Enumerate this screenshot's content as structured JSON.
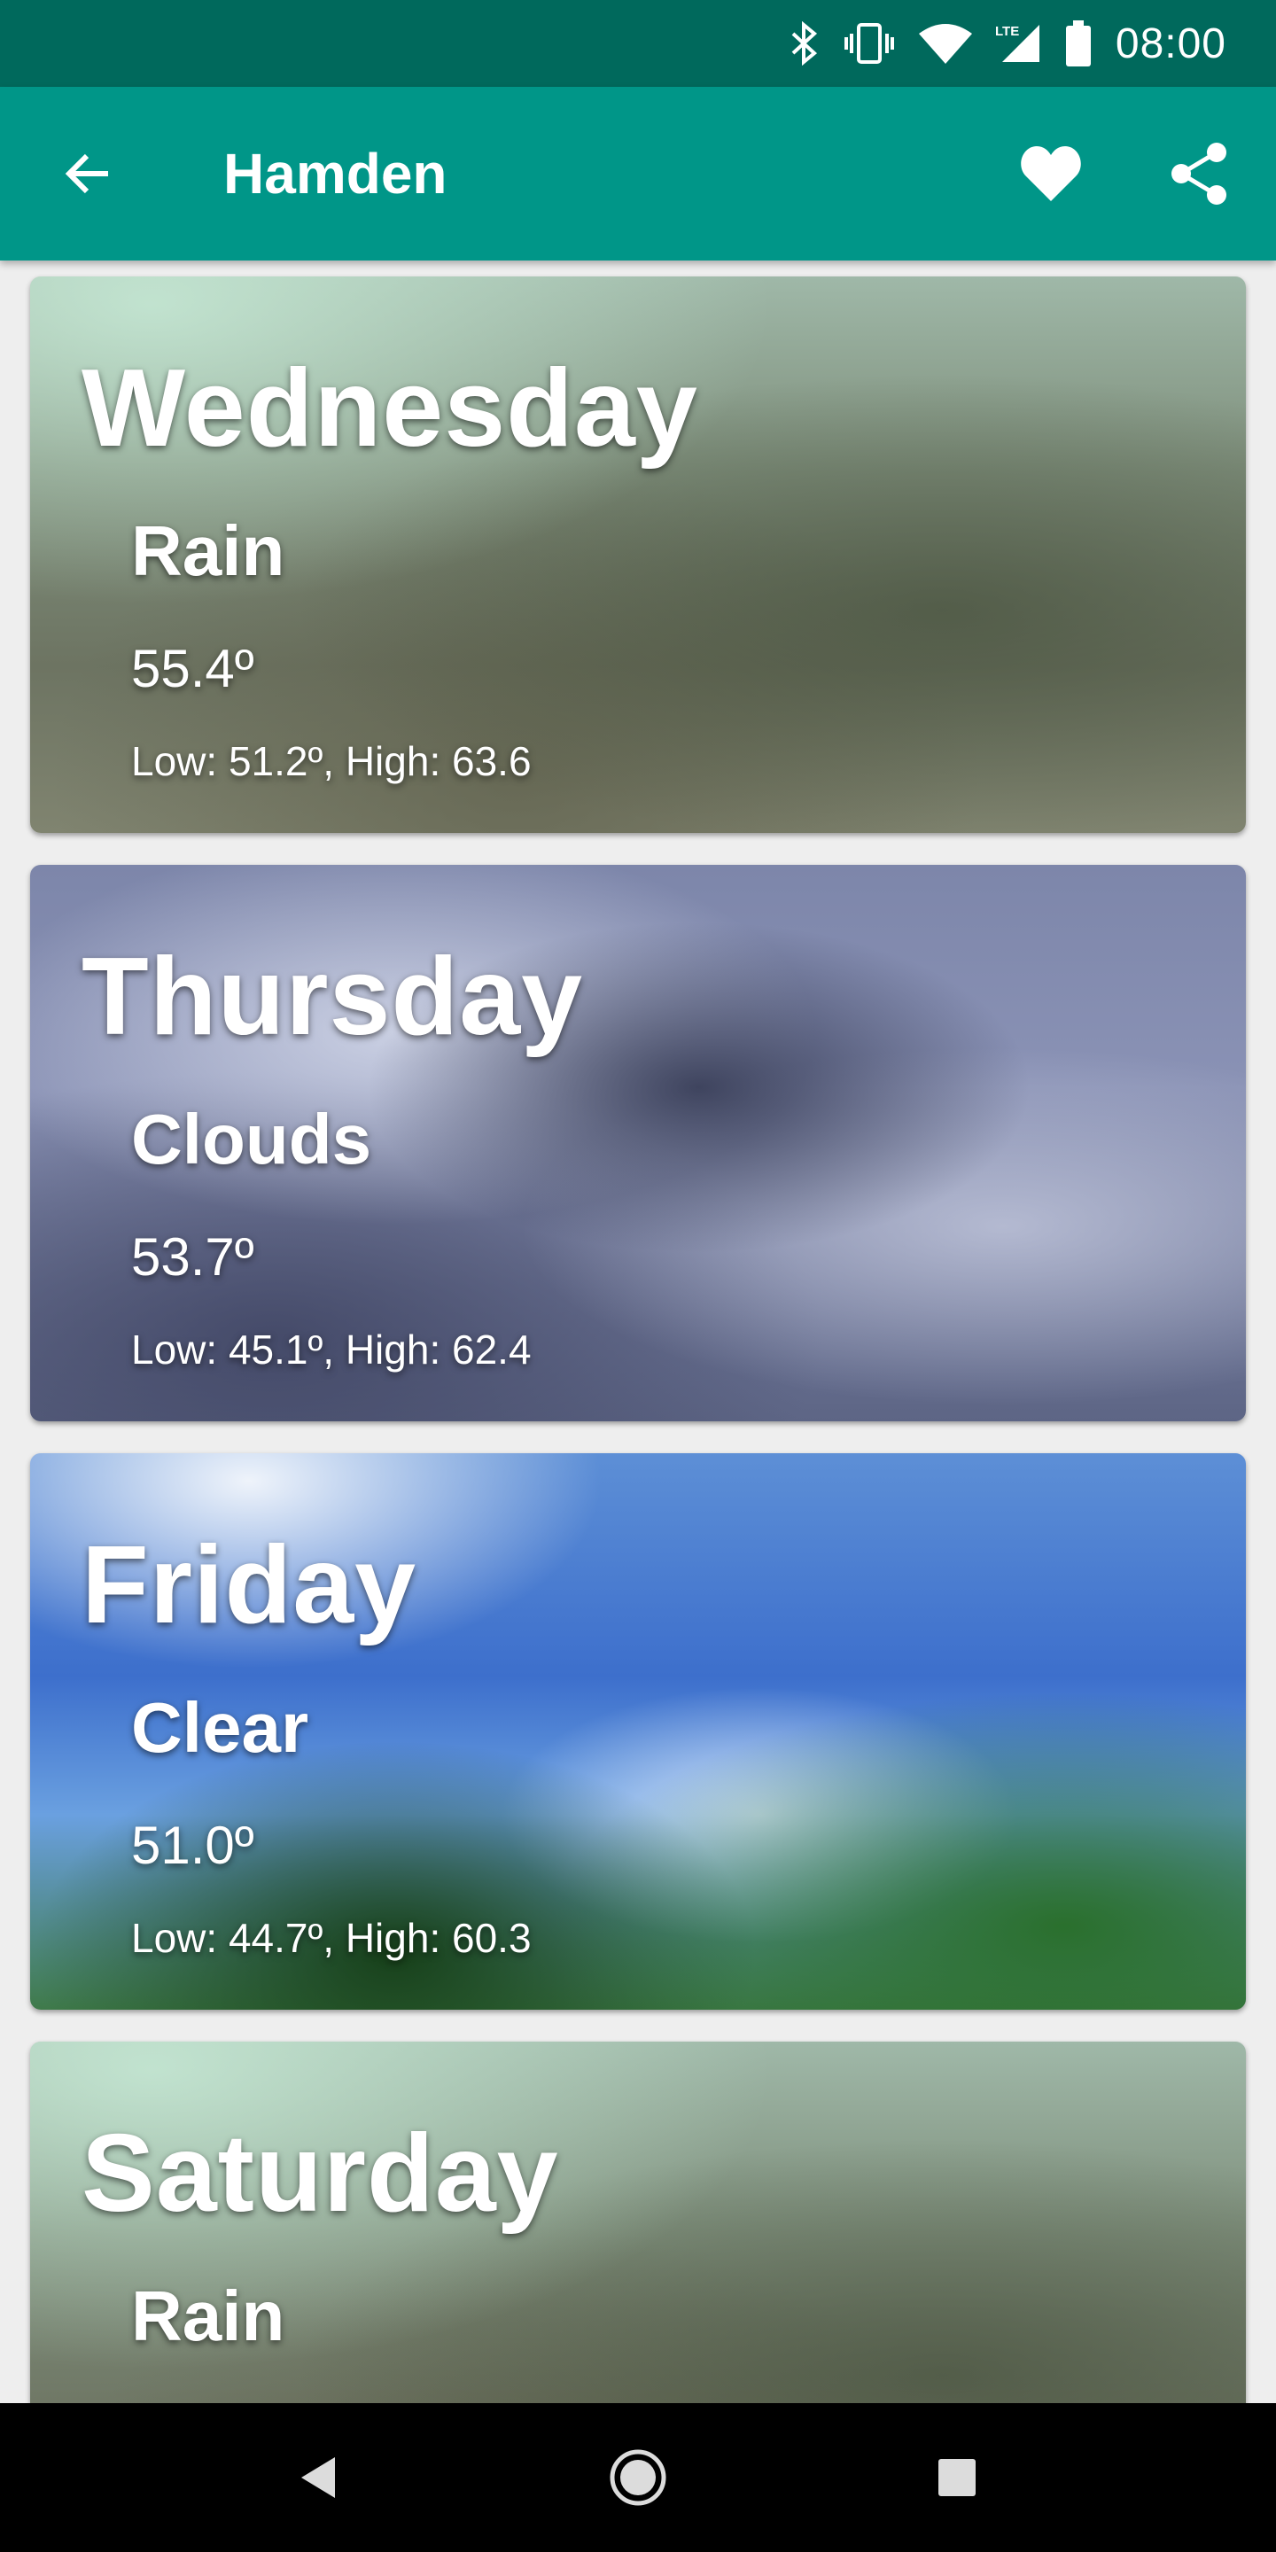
{
  "status_bar": {
    "time": "08:00",
    "icons": [
      "bluetooth-icon",
      "vibrate-icon",
      "wifi-icon",
      "lte-signal-icon",
      "battery-icon"
    ]
  },
  "app_bar": {
    "title": "Hamden",
    "background_color": "#009688",
    "status_color": "#00695c"
  },
  "forecast": [
    {
      "day": "Wednesday",
      "condition": "Rain",
      "temp": "55.4º",
      "range": "Low: 51.2º, High: 63.6"
    },
    {
      "day": "Thursday",
      "condition": "Clouds",
      "temp": "53.7º",
      "range": "Low: 45.1º, High: 62.4"
    },
    {
      "day": "Friday",
      "condition": "Clear",
      "temp": "51.0º",
      "range": "Low: 44.7º, High: 60.3"
    },
    {
      "day": "Saturday",
      "condition": "Rain",
      "temp": "",
      "range": ""
    }
  ],
  "nav_bar": {
    "icons": [
      "back-nav-icon",
      "home-nav-icon",
      "recents-nav-icon"
    ]
  }
}
